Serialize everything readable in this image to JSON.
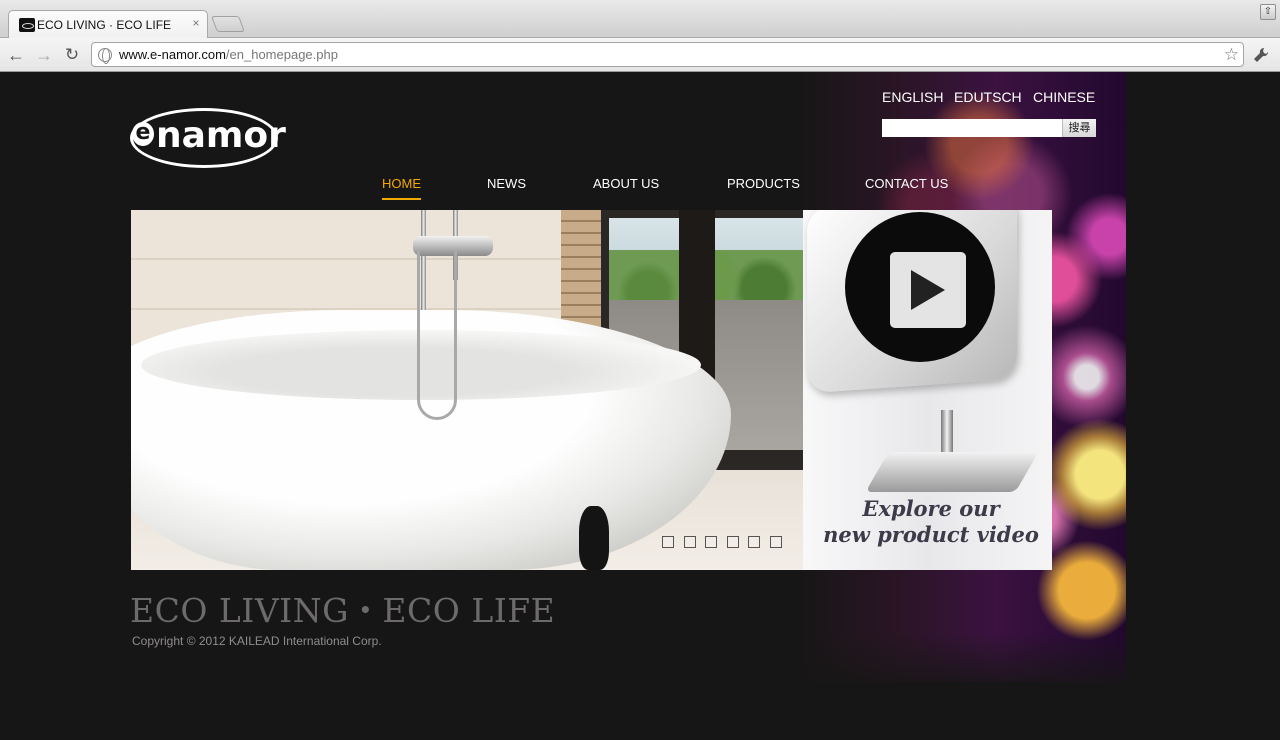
{
  "browser": {
    "tab_title": "ECO LIVING · ECO LIFE",
    "tab_close": "×",
    "url_host": "www.e-namor.com",
    "url_path": "/en_homepage.php",
    "back": "←",
    "forward": "→",
    "reload": "↻",
    "bookmark_star": "☆",
    "wrench": "🔧",
    "window_control": "⇧"
  },
  "site": {
    "logo_e": "e",
    "logo_text": "namor",
    "languages": [
      "ENGLISH",
      "EDUTSCH",
      "CHINESE T"
    ],
    "search": {
      "placeholder": "",
      "button_label": "搜尋"
    },
    "nav": [
      {
        "label": "HOME",
        "active": true
      },
      {
        "label": "NEWS",
        "active": false
      },
      {
        "label": "ABOUT US",
        "active": false
      },
      {
        "label": "PRODUCTS",
        "active": false
      },
      {
        "label": "CONTACT US",
        "active": false
      }
    ],
    "hero": {
      "slide_count": 6,
      "video_caption_line1": "Explore our",
      "video_caption_line2": "new product video"
    },
    "tagline": "ECO LIVING・ECO LIFE",
    "copyright": "Copyright ©  2012 KAILEAD International Corp."
  },
  "colors": {
    "page_background": "#171616",
    "nav_active": "#f2a900",
    "nav_text": "#ffffff",
    "tagline": "#6d6b6a"
  }
}
